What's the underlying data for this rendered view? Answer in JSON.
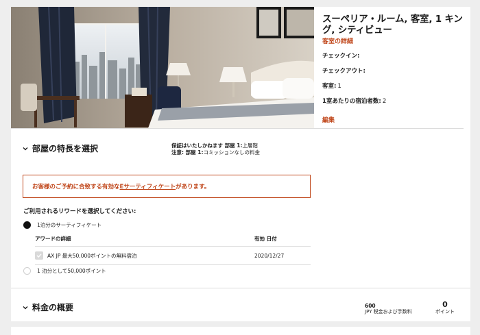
{
  "room": {
    "title": "スーペリア・ルーム, 客室, 1 キング, シティビュー",
    "details_link": "客室の詳細",
    "check_in_label": "チェックイン:",
    "check_out_label": "チェックアウト:",
    "rooms_label": "客室:",
    "rooms_value": "1",
    "guests_label": "1室あたりの宿泊者数:",
    "guests_value": "2",
    "edit_link": "編集"
  },
  "features": {
    "title": "部屋の特長を選択",
    "guarantee_label": "保証はいたしかねます 部屋 1:",
    "guarantee_value": "上層階",
    "note_label": "注意: 部屋 1:",
    "note_value": "コミッションなしの料金"
  },
  "certificate": {
    "text_before": "お客様のご予約に合致する有効な",
    "link": "Eサーティフィケート",
    "text_after": "があります。"
  },
  "rewards": {
    "prompt": "ご利用されるリワードを選択してください:",
    "option1_label": "1泊分のサーティフィケート",
    "option1_selected": true,
    "table_header_detail": "アワードの詳細",
    "table_header_date": "有効 日付",
    "award_description": "AX JP 最大50,000ポイントの無料宿泊",
    "award_date": "2020/12/27",
    "award_checked": true,
    "option2_label": "1 泊分として50,000ポイント",
    "option2_selected": false
  },
  "summary": {
    "title": "料金の概要",
    "price_amount": "600",
    "price_caption": "JPY 税金および手数料",
    "points_amount": "0",
    "points_caption": "ポイント"
  },
  "colors": {
    "accent": "#c0461a",
    "text": "#1c1c1c",
    "background": "#eeeeee",
    "divider": "#dcdcdc"
  }
}
